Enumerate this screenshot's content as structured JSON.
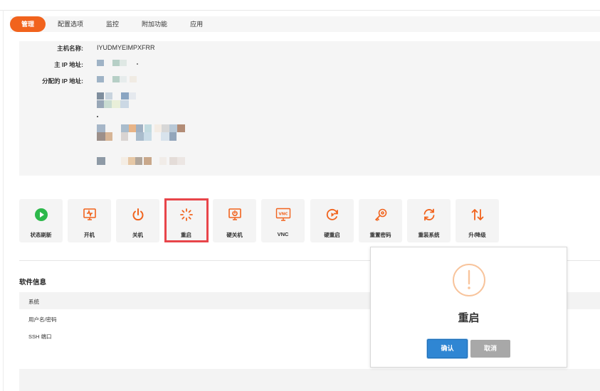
{
  "tabs": [
    {
      "label": "管理",
      "active": true
    },
    {
      "label": "配置选项"
    },
    {
      "label": "监控"
    },
    {
      "label": "附加功能"
    },
    {
      "label": "应用"
    }
  ],
  "info": {
    "hostname_label": "主机名称:",
    "hostname_value": "IYUDMYEIMPXFRR",
    "main_ip_label": "主 IP 地址:",
    "assigned_ip_label": "分配的 IP 地址:"
  },
  "actions": [
    {
      "label": "状态刷新",
      "icon": "refresh-play-icon"
    },
    {
      "label": "开机",
      "icon": "power-on-icon"
    },
    {
      "label": "关机",
      "icon": "power-off-icon"
    },
    {
      "label": "重启",
      "icon": "restart-icon"
    },
    {
      "label": "硬关机",
      "icon": "hard-shutdown-icon"
    },
    {
      "label": "VNC",
      "icon": "vnc-icon"
    },
    {
      "label": "硬重启",
      "icon": "hard-restart-icon"
    },
    {
      "label": "重置密码",
      "icon": "key-icon"
    },
    {
      "label": "重装系统",
      "icon": "reinstall-icon"
    },
    {
      "label": "升/降级",
      "icon": "upgrade-downgrade-icon"
    }
  ],
  "software": {
    "title": "软件信息",
    "rows": [
      "系统",
      "用户名/密码",
      "SSH 端口"
    ]
  },
  "modal": {
    "title": "重启",
    "confirm_label": "确认",
    "cancel_label": "取消"
  },
  "colors": {
    "accent": "#f1631d",
    "primary_button": "#2f86d3",
    "cancel_button": "#a8a8a8",
    "highlight": "#e8454a",
    "status_green": "#2db84b"
  }
}
